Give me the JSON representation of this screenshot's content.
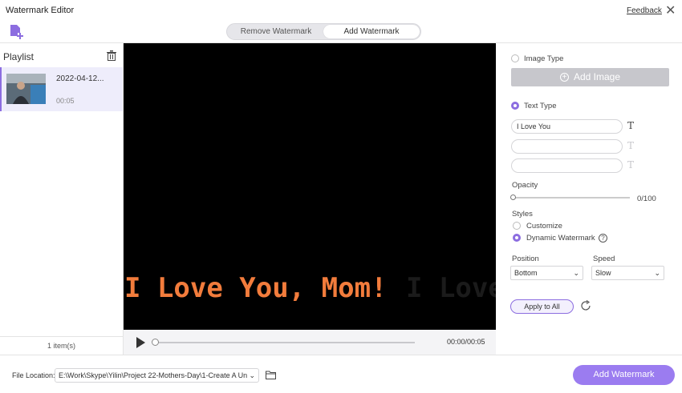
{
  "window": {
    "title": "Watermark Editor",
    "feedback_label": "Feedback",
    "close_glyph": "✕"
  },
  "toolbar": {
    "add_file_icon": "add-file-icon",
    "tabs": [
      {
        "label": "Remove Watermark",
        "active": false
      },
      {
        "label": "Add Watermark",
        "active": true
      }
    ]
  },
  "playlist": {
    "title": "Playlist",
    "items": [
      {
        "name": "2022-04-12...",
        "duration": "00:05",
        "selected": true
      }
    ],
    "count_label": "1 item(s)"
  },
  "video": {
    "watermark_text": "I Love You, Mom!",
    "watermark_color": "#f27c3c",
    "ghost_text": "I Love",
    "time_display": "00:00/00:05",
    "progress": 0
  },
  "panel": {
    "image_type_label": "Image Type",
    "add_image_label": "Add Image",
    "text_type_label": "Text Type",
    "text_type_selected": true,
    "text_inputs": [
      "I Love You",
      "",
      ""
    ],
    "opacity_label": "Opacity",
    "opacity_value": "0/100",
    "styles_label": "Styles",
    "style_customize": "Customize",
    "style_dynamic": "Dynamic Watermark",
    "style_selected": "Dynamic Watermark",
    "help_glyph": "?",
    "position_label": "Position",
    "position_value": "Bottom",
    "speed_label": "Speed",
    "speed_value": "Slow",
    "apply_all_label": "Apply to All"
  },
  "footer": {
    "file_location_label": "File Location:",
    "path": "E:\\Work\\Skype\\Yilin\\Project 22-Mothers-Day\\1-Create A Un",
    "add_watermark_label": "Add Watermark"
  },
  "colors": {
    "accent": "#8c6de0",
    "primary_button": "#9b7cf0",
    "video_bg": "#000000"
  }
}
